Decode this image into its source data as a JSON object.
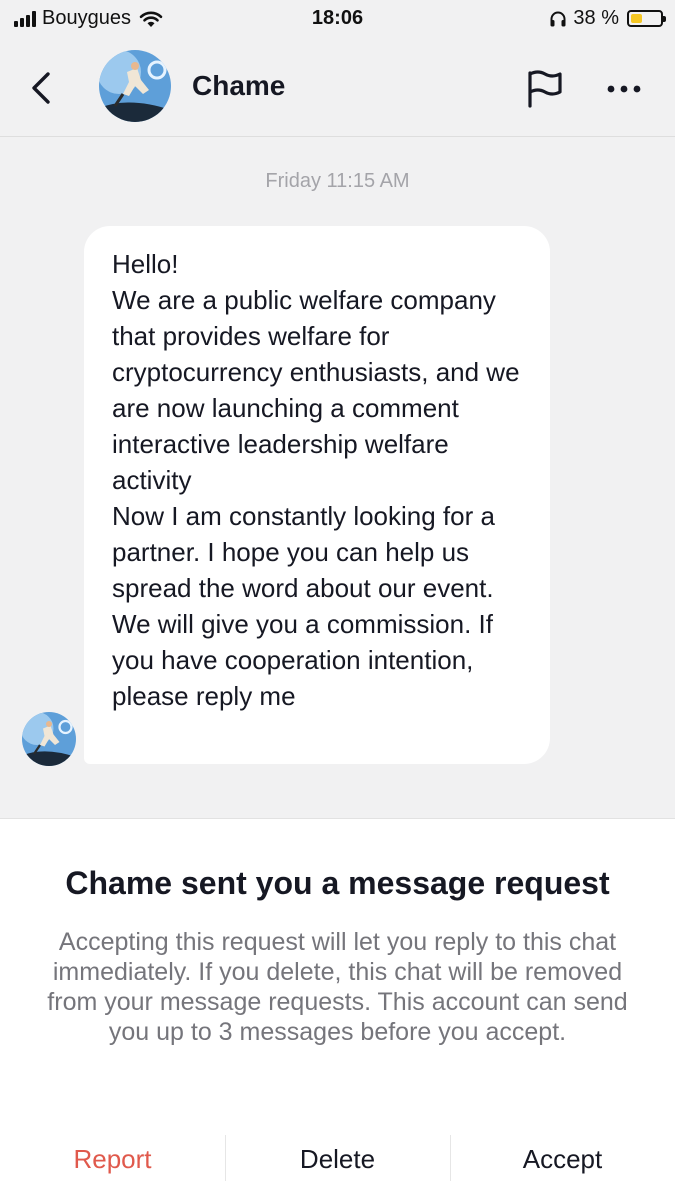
{
  "status_bar": {
    "carrier": "Bouygues",
    "time": "18:06",
    "battery_percent": "38 %",
    "battery_level": 0.38,
    "icons": [
      "signal-icon",
      "wifi-icon",
      "headphones-icon",
      "battery-icon"
    ]
  },
  "header": {
    "contact_name": "Chame",
    "icons": [
      "back-arrow-icon",
      "flag-icon",
      "more-icon"
    ]
  },
  "chat": {
    "timestamp": "Friday 11:15 AM",
    "message": "Hello!\nWe are a public welfare company that provides welfare for cryptocurrency enthusiasts, and we are now launching a comment interactive leadership welfare activity\nNow I am constantly looking for a partner. I hope you can help us spread the word about our event. We will give you a commission. If you have cooperation intention, please reply me"
  },
  "request": {
    "title": "Chame sent you a message request",
    "description": "Accepting this request will let you reply to this chat immediately. If you delete, this chat will be removed from your message requests. This account can send you up to 3 messages before you accept.",
    "report_label": "Report",
    "delete_label": "Delete",
    "accept_label": "Accept"
  },
  "colors": {
    "report": "#e0594c",
    "background": "#f1f1f2",
    "bubble": "#ffffff",
    "muted_text": "#75757b"
  }
}
